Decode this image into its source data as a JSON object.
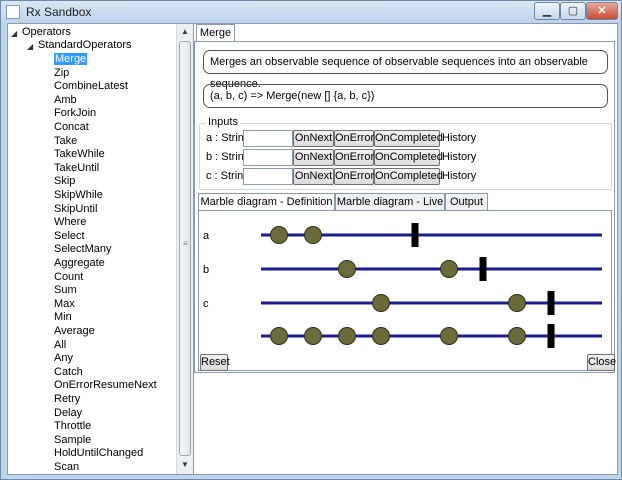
{
  "window": {
    "title": "Rx Sandbox"
  },
  "tree": {
    "root": "Operators",
    "group": "StandardOperators",
    "selected_index": 0,
    "items": [
      "Merge",
      "Zip",
      "CombineLatest",
      "Amb",
      "ForkJoin",
      "Concat",
      "Take",
      "TakeWhile",
      "TakeUntil",
      "Skip",
      "SkipWhile",
      "SkipUntil",
      "Where",
      "Select",
      "SelectMany",
      "Aggregate",
      "Count",
      "Sum",
      "Max",
      "Min",
      "Average",
      "All",
      "Any",
      "Catch",
      "OnErrorResumeNext",
      "Retry",
      "Delay",
      "Throttle",
      "Sample",
      "HoldUntilChanged",
      "Scan"
    ]
  },
  "main_tab": "Merge",
  "description": "Merges an observable sequence of observable sequences into an observable sequence.",
  "code": "(a, b, c) => Merge(new [] {a, b, c})",
  "inputs": {
    "legend": "Inputs",
    "rows": [
      {
        "label": "a : String",
        "value": "",
        "on_next": "OnNext",
        "on_error": "OnError",
        "on_completed": "OnCompleted",
        "history": "History"
      },
      {
        "label": "b : String",
        "value": "",
        "on_next": "OnNext",
        "on_error": "OnError",
        "on_completed": "OnCompleted",
        "history": "History"
      },
      {
        "label": "c : String",
        "value": "",
        "on_next": "OnNext",
        "on_error": "OnError",
        "on_completed": "OnCompleted",
        "history": "History"
      }
    ]
  },
  "diagram_tabs": [
    "Marble diagram - Definition",
    "Marble diagram - Live",
    "Output"
  ],
  "active_diagram_tab": 0,
  "marble": {
    "line_color": "#1c1c8c",
    "marble_color": "#6b6b3a",
    "rows": [
      {
        "label": "a",
        "marbles": [
          1,
          2
        ],
        "complete": 5
      },
      {
        "label": "b",
        "marbles": [
          3,
          6
        ],
        "complete": 7
      },
      {
        "label": "c",
        "marbles": [
          4,
          8
        ],
        "complete": 9
      },
      {
        "label": "",
        "marbles": [
          1,
          2,
          3,
          4,
          6,
          8
        ],
        "complete": 9
      }
    ]
  },
  "buttons": {
    "reset": "Reset",
    "close": "Close"
  }
}
